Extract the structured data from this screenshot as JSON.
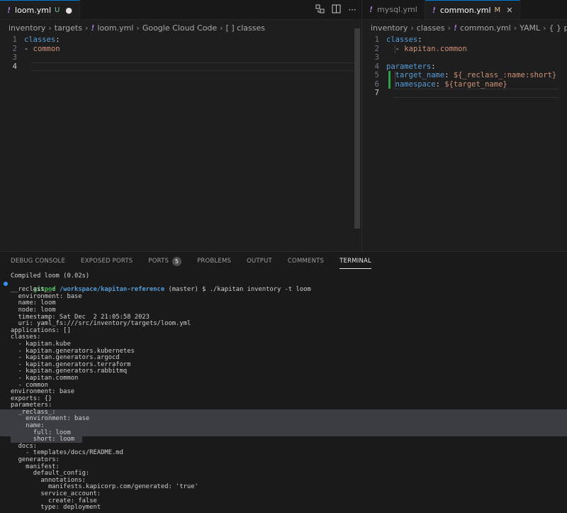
{
  "left_group": {
    "tabs": [
      {
        "icon": "!",
        "label": "loom.yml",
        "badge": "U",
        "dirty": "●"
      }
    ],
    "breadcrumb": [
      "inventory",
      "targets",
      "loom.yml",
      "Google Cloud Code",
      "[ ] classes"
    ],
    "lines": [
      {
        "n": "1",
        "parts": [
          {
            "c": "k",
            "t": "classes"
          },
          {
            "c": "p",
            "t": ":"
          }
        ]
      },
      {
        "n": "2",
        "parts": [
          {
            "c": "p",
            "t": "- "
          },
          {
            "c": "s",
            "t": "common"
          }
        ]
      },
      {
        "n": "3",
        "parts": []
      },
      {
        "n": "4",
        "parts": []
      }
    ]
  },
  "right_group": {
    "tabs": [
      {
        "icon": "!",
        "label": "mysql.yml"
      },
      {
        "icon": "!",
        "label": "common.yml",
        "badge": "M",
        "close": "✕"
      }
    ],
    "breadcrumb": [
      "inventory",
      "classes",
      "common.yml",
      "YAML",
      "{ } parameters"
    ],
    "lines": [
      {
        "n": "1",
        "parts": [
          {
            "c": "k",
            "t": "classes"
          },
          {
            "c": "p",
            "t": ":"
          }
        ]
      },
      {
        "n": "2",
        "parts": [
          {
            "c": "p",
            "t": "  - "
          },
          {
            "c": "s",
            "t": "kapitan.common"
          }
        ]
      },
      {
        "n": "3",
        "parts": []
      },
      {
        "n": "4",
        "parts": [
          {
            "c": "k",
            "t": "parameters"
          },
          {
            "c": "p",
            "t": ":"
          }
        ]
      },
      {
        "n": "5",
        "parts": [
          {
            "c": "p",
            "t": "  "
          },
          {
            "c": "k",
            "t": "target_name"
          },
          {
            "c": "p",
            "t": ": "
          },
          {
            "c": "s",
            "t": "${_reclass_:name:short}"
          }
        ]
      },
      {
        "n": "6",
        "parts": [
          {
            "c": "p",
            "t": "  "
          },
          {
            "c": "k",
            "t": "namespace"
          },
          {
            "c": "p",
            "t": ": "
          },
          {
            "c": "s",
            "t": "${target_name}"
          }
        ]
      },
      {
        "n": "7",
        "parts": []
      }
    ]
  },
  "panel": {
    "tabs": [
      {
        "label": "DEBUG CONSOLE"
      },
      {
        "label": "EXPOSED PORTS"
      },
      {
        "label": "PORTS",
        "count": "5"
      },
      {
        "label": "PROBLEMS"
      },
      {
        "label": "OUTPUT"
      },
      {
        "label": "COMMENTS"
      },
      {
        "label": "TERMINAL",
        "active": true
      }
    ]
  },
  "terminal": {
    "prompt": {
      "user": "gitpod",
      "path": "/workspace/kapitan-reference",
      "rest": " (master) $ ./kapitan inventory -t loom"
    },
    "lines_before": [
      "Compiled loom (0.02s)"
    ],
    "lines": [
      "__reclass__:",
      "  environment: base",
      "  name: loom",
      "  node: loom",
      "  timestamp: Sat Dec  2 21:05:58 2023",
      "  uri: yaml_fs:///src/inventory/targets/loom.yml",
      "applications: []",
      "classes:",
      "  - kapitan.kube",
      "  - kapitan.generators.kubernetes",
      "  - kapitan.generators.argocd",
      "  - kapitan.generators.terraform",
      "  - kapitan.generators.rabbitmq",
      "  - kapitan.common",
      "  - common",
      "environment: base",
      "exports: {}",
      "parameters:",
      "  _reclass_:",
      "    environment: base",
      "    name:",
      "      full: loom",
      "      short: loom",
      "  docs:",
      "    - templates/docs/README.md",
      "  generators:",
      "    manifest:",
      "      default_config:",
      "        annotations:",
      "          manifests.kapicorp.com/generated: 'true'",
      "        service_account:",
      "          create: false",
      "        type: deployment"
    ]
  }
}
